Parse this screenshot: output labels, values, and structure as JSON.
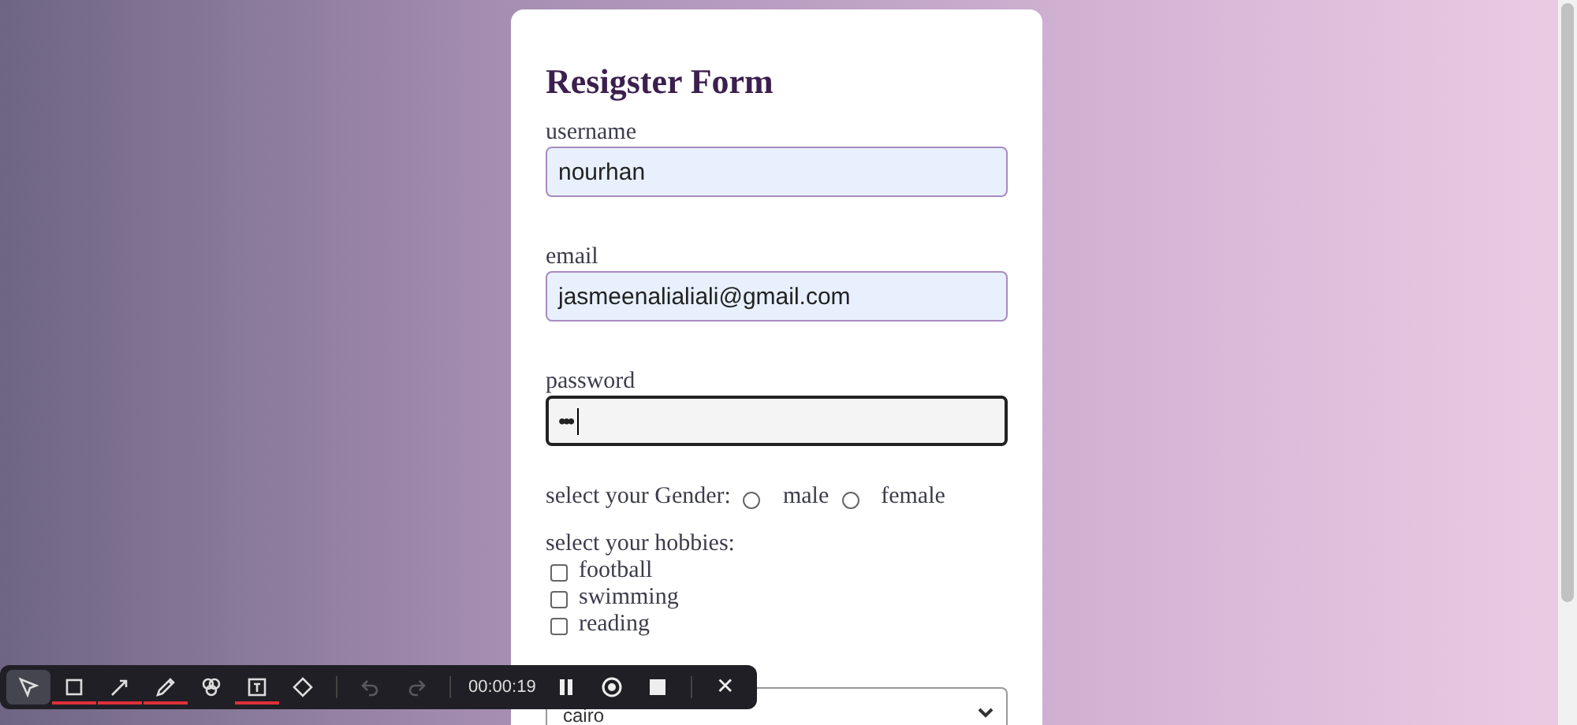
{
  "form": {
    "title": "Resigster Form",
    "fields": [
      {
        "label": "username",
        "value": "nourhan",
        "focused": false,
        "kind": "text"
      },
      {
        "label": "email",
        "value": "jasmeenalialiali@gmail.com",
        "focused": false,
        "kind": "text"
      },
      {
        "label": "password",
        "value": "•••",
        "focused": true,
        "kind": "password"
      }
    ],
    "gender": {
      "label": "select your Gender:",
      "options": [
        {
          "label": "male",
          "selected": false
        },
        {
          "label": "female",
          "selected": false
        }
      ]
    },
    "hobbies": {
      "label": "select your hobbies:",
      "options": [
        {
          "label": "football",
          "checked": false
        },
        {
          "label": "swimming",
          "checked": false
        },
        {
          "label": "reading",
          "checked": false
        }
      ]
    },
    "city_select": {
      "value": "cairo"
    }
  },
  "recorder_toolbar": {
    "tools": [
      {
        "kind": "pointer",
        "selected": true,
        "marked": false
      },
      {
        "kind": "rectangle",
        "selected": false,
        "marked": true
      },
      {
        "kind": "arrow",
        "selected": false,
        "marked": true
      },
      {
        "kind": "pen",
        "selected": false,
        "marked": true
      },
      {
        "kind": "shapes",
        "selected": false,
        "marked": false
      },
      {
        "kind": "text",
        "selected": false,
        "marked": true
      },
      {
        "kind": "eraser",
        "selected": false,
        "marked": false
      }
    ],
    "history": [
      {
        "kind": "undo",
        "disabled": true
      },
      {
        "kind": "redo",
        "disabled": true
      }
    ],
    "timer": "00:00:19",
    "controls": [
      {
        "kind": "pause"
      },
      {
        "kind": "record"
      },
      {
        "kind": "stop"
      }
    ],
    "close": "✕"
  }
}
